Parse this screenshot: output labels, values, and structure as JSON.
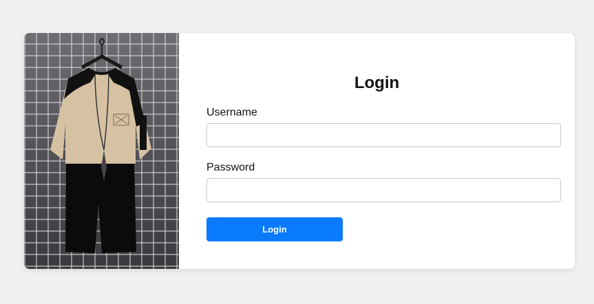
{
  "login": {
    "title": "Login",
    "username_label": "Username",
    "username_value": "",
    "password_label": "Password",
    "password_value": "",
    "submit_label": "Login"
  },
  "image": {
    "subject": "hanging-tshirt-and-shorts-outfit"
  },
  "colors": {
    "page_background": "#f0f0f0",
    "card_background": "#ffffff",
    "button_background": "#0a7bff",
    "button_text": "#ffffff",
    "input_border": "#c9c9c9"
  }
}
